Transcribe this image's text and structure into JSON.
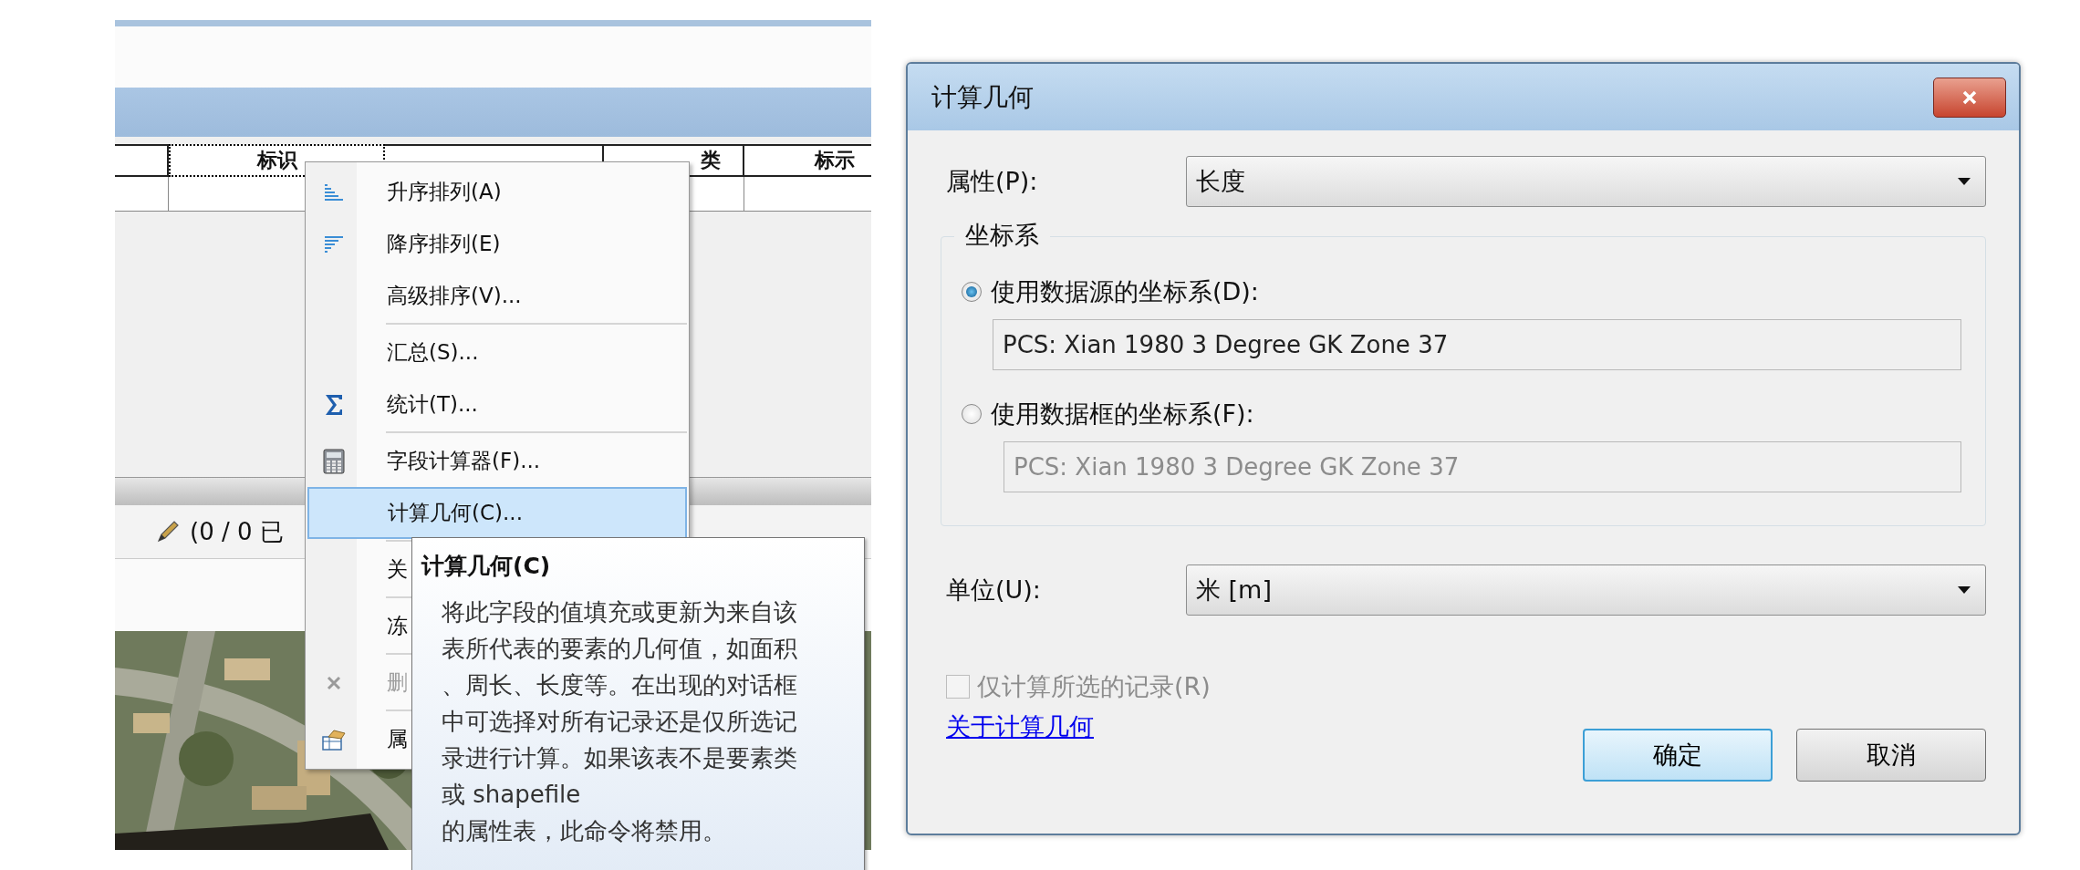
{
  "table": {
    "columns": [
      "标识",
      "类",
      "标示"
    ]
  },
  "status": {
    "text": "(0 / 0 已"
  },
  "menu": {
    "groups": [
      [
        {
          "label": "升序排列(A)",
          "kind": "ascending",
          "selected": false,
          "disabled": false
        },
        {
          "label": "降序排列(E)",
          "kind": "descending",
          "selected": false,
          "disabled": false
        },
        {
          "label": "高级排序(V)...",
          "kind": "plain",
          "selected": false,
          "disabled": false
        }
      ],
      [
        {
          "label": "汇总(S)...",
          "kind": "plain",
          "selected": false,
          "disabled": false
        },
        {
          "label": "统计(T)...",
          "kind": "sum",
          "selected": false,
          "disabled": false
        }
      ],
      [
        {
          "label": "字段计算器(F)...",
          "kind": "calculator",
          "selected": false,
          "disabled": false
        },
        {
          "label": "计算几何(C)...",
          "kind": "plain",
          "selected": true,
          "disabled": false
        }
      ],
      [
        {
          "label": "关",
          "kind": "plain",
          "selected": false,
          "disabled": false
        }
      ],
      [
        {
          "label": "冻",
          "kind": "plain",
          "selected": false,
          "disabled": false
        }
      ],
      [
        {
          "label": "删",
          "kind": "delete",
          "selected": false,
          "disabled": true
        }
      ],
      [
        {
          "label": "属",
          "kind": "properties",
          "selected": false,
          "disabled": false
        }
      ]
    ]
  },
  "tooltip": {
    "title": "计算几何(C)",
    "text": "将此字段的值填充或更新为来自该表所代表的要素的几何值，如面积、周长、长度等。在出现的对话框中可选择对所有记录还是仅所选记录进行计算。如果该表不是要素类或 shapefile\n的属性表，此命令将禁用。"
  },
  "dialog": {
    "title": "计算几何",
    "property": {
      "label": "属性(P):",
      "value": "长度"
    },
    "group": {
      "legend": "坐标系",
      "options": [
        {
          "label": "使用数据源的坐标系(D):",
          "selected": true,
          "value": "PCS: Xian 1980 3 Degree GK Zone 37"
        },
        {
          "label": "使用数据框的坐标系(F):",
          "selected": false,
          "value": "PCS: Xian 1980 3 Degree GK Zone 37"
        }
      ]
    },
    "unit": {
      "label": "单位(U):",
      "value": "米 [m]"
    },
    "checkbox": {
      "label": "仅计算所选的记录(R)",
      "checked": false,
      "disabled": true
    },
    "link": "关于计算几何",
    "buttons": [
      {
        "label": "确定",
        "default": true
      },
      {
        "label": "取消",
        "default": false
      }
    ]
  }
}
